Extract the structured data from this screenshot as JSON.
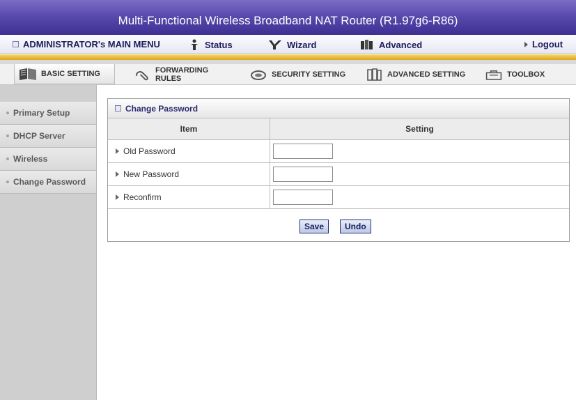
{
  "title": "Multi-Functional Wireless Broadband NAT Router (R1.97g6-R86)",
  "menu": {
    "main": "ADMINISTRATOR's MAIN MENU",
    "status": "Status",
    "wizard": "Wizard",
    "advanced": "Advanced",
    "logout": "Logout"
  },
  "tabs": [
    {
      "label": "BASIC SETTING",
      "icon": "book-icon",
      "active": true
    },
    {
      "label": "FORWARDING RULES",
      "icon": "paperclip-icon"
    },
    {
      "label": "SECURITY SETTING",
      "icon": "lock-icon"
    },
    {
      "label": "ADVANCED SETTING",
      "icon": "books-icon"
    },
    {
      "label": "TOOLBOX",
      "icon": "toolbox-icon"
    }
  ],
  "sidebar": {
    "items": [
      {
        "label": "Primary Setup"
      },
      {
        "label": "DHCP Server"
      },
      {
        "label": "Wireless"
      },
      {
        "label": "Change Password"
      }
    ]
  },
  "panel": {
    "title": "Change Password",
    "col_item": "Item",
    "col_setting": "Setting",
    "rows": [
      {
        "label": "Old Password",
        "value": ""
      },
      {
        "label": "New Password",
        "value": ""
      },
      {
        "label": "Reconfirm",
        "value": ""
      }
    ],
    "save": "Save",
    "undo": "Undo"
  },
  "colors": {
    "titlebar": "#5a4aae",
    "accent_yellow": "#e9b93c",
    "button_border": "#1d2f7a"
  }
}
